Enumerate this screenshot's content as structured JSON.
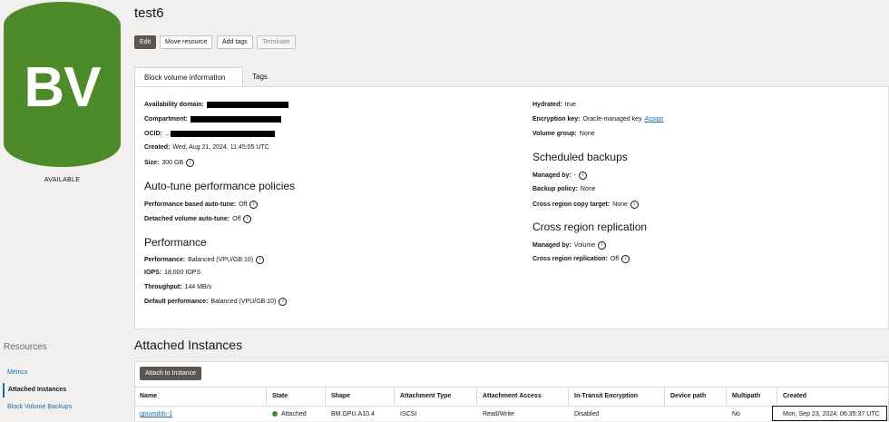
{
  "resource": {
    "logo_text": "BV",
    "status": "AVAILABLE",
    "title": "test6"
  },
  "actions": {
    "edit": "Edit",
    "move": "Move resource",
    "add_tags": "Add tags",
    "terminate": "Terminate"
  },
  "tabs": [
    "Block volume information",
    "Tags"
  ],
  "left_details": {
    "availability_domain_label": "Availability domain:",
    "compartment_label": "Compartment:",
    "ocid_label": "OCID:",
    "ocid_prefix": "...",
    "created_label": "Created:",
    "created_value": "Wed, Aug 21, 2024, 11:45:05 UTC",
    "size_label": "Size:",
    "size_value": "300 GB"
  },
  "autotune": {
    "heading": "Auto-tune performance policies",
    "perf_label": "Performance based auto-tune:",
    "perf_value": "Off",
    "detached_label": "Detached volume auto-tune:",
    "detached_value": "Off"
  },
  "performance": {
    "heading": "Performance",
    "perf_label": "Performance:",
    "perf_value": "Balanced (VPU/GB:10)",
    "iops_label": "IOPS:",
    "iops_value": "18,000 IOPS",
    "throughput_label": "Throughput:",
    "throughput_value": "144 MB/s",
    "default_label": "Default performance:",
    "default_value": "Balanced (VPU/GB:10)"
  },
  "right_details": {
    "hydrated_label": "Hydrated:",
    "hydrated_value": "true",
    "encryption_label": "Encryption key:",
    "encryption_value": "Oracle-managed key",
    "assign_link": "Assign",
    "volume_group_label": "Volume group:",
    "volume_group_value": "None"
  },
  "scheduled": {
    "heading": "Scheduled backups",
    "managed_label": "Managed by:",
    "managed_value": "-",
    "policy_label": "Backup policy:",
    "policy_value": "None",
    "copy_label": "Cross region copy target:",
    "copy_value": "None"
  },
  "replication": {
    "heading": "Cross region replication",
    "managed_label": "Managed by:",
    "managed_value": "Volume",
    "repl_label": "Cross region replication:",
    "repl_value": "Off"
  },
  "resources": {
    "title": "Resources",
    "items": [
      "Metrics",
      "Attached Instances",
      "Block Volume Backups"
    ]
  },
  "attached": {
    "title": "Attached Instances",
    "button": "Attach to Instance",
    "columns": [
      "Name",
      "State",
      "Shape",
      "Attachment Type",
      "Attachment Access",
      "In-Transit Encryption",
      "Device path",
      "Multipath",
      "Created"
    ],
    "rows": [
      [
        "gpuvsddc-1",
        "Attached",
        "BM.GPU.A10.4",
        "ISCSI",
        "Read/Write",
        "Disabled",
        "",
        "No",
        "Mon, Sep 23, 2024, 06:35:37 UTC"
      ]
    ]
  },
  "colors": {
    "brand_green": "#4c8a2a",
    "link_blue": "#1d6aa5",
    "primary_button": "#5b5652"
  }
}
